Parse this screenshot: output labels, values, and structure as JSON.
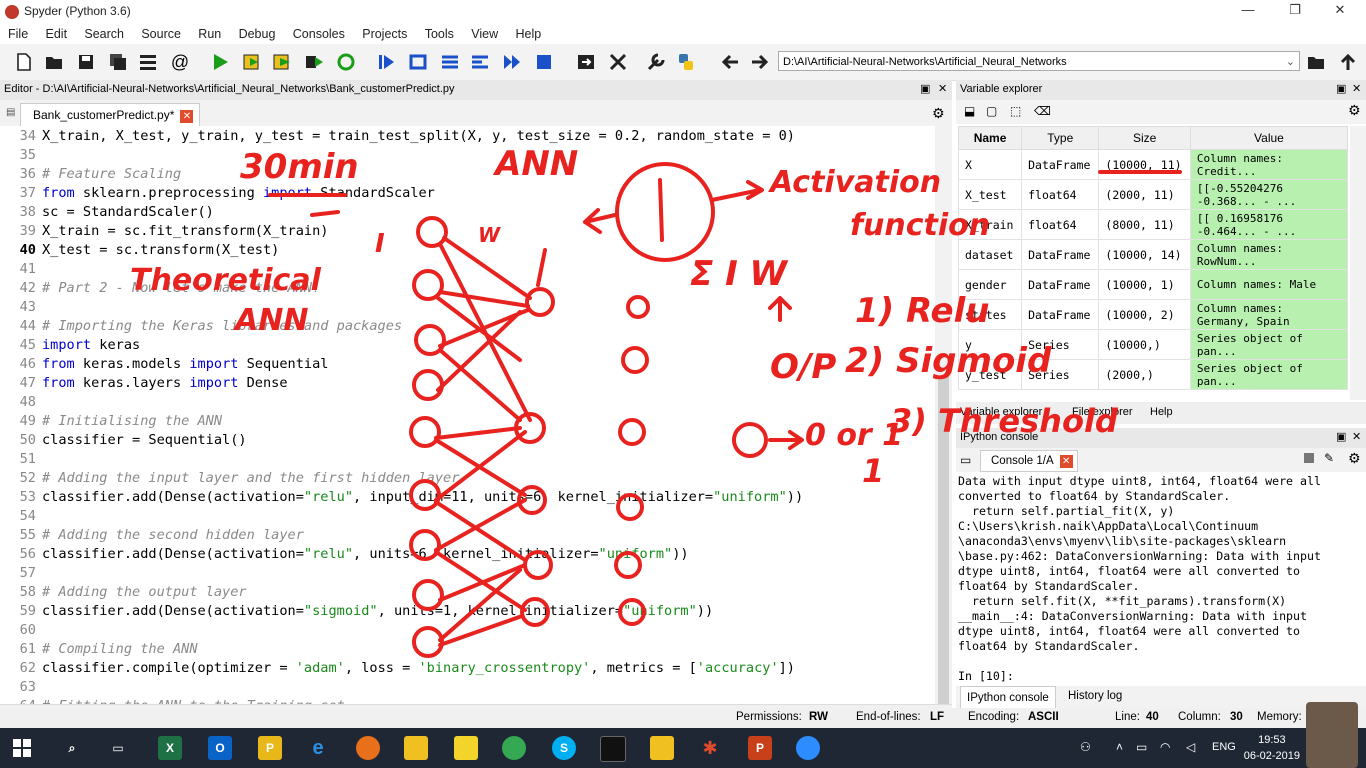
{
  "window": {
    "title": "Spyder (Python 3.6)",
    "minimize": "—",
    "restore": "❐",
    "close": "✕"
  },
  "menu": [
    "File",
    "Edit",
    "Search",
    "Source",
    "Run",
    "Debug",
    "Consoles",
    "Projects",
    "Tools",
    "View",
    "Help"
  ],
  "toolbar": {
    "path": "D:\\AI\\Artificial-Neural-Networks\\Artificial_Neural_Networks",
    "icons": [
      "new-file-icon",
      "open-file-icon",
      "save-icon",
      "save-all-icon",
      "outline-icon",
      "at-icon",
      "run-icon",
      "run-cell-icon",
      "run-cell-advance-icon",
      "run-selection-icon",
      "rerun-icon",
      "debug-icon",
      "step-icon",
      "step-into-icon",
      "step-return-icon",
      "continue-icon",
      "stop-icon",
      "maximize-pane-icon",
      "fullscreen-icon",
      "preferences-icon",
      "python-path-icon",
      "back-arrow-icon",
      "forward-arrow-icon"
    ]
  },
  "editor": {
    "header": "Editor - D:\\AI\\Artificial-Neural-Networks\\Artificial_Neural_Networks\\Bank_customerPredict.py",
    "tab": "Bank_customerPredict.py*",
    "lines": [
      {
        "n": "34",
        "text": "X_train, X_test, y_train, y_test = train_test_split(X, y, test_size = 0.2, random_state = 0)",
        "cls": ""
      },
      {
        "n": "35",
        "text": "",
        "cls": ""
      },
      {
        "n": "36",
        "text": "# Feature Scaling",
        "cls": "cm"
      },
      {
        "n": "37",
        "text": "from sklearn.preprocessing import StandardScaler",
        "cls": ""
      },
      {
        "n": "38",
        "text": "sc = StandardScaler()",
        "cls": ""
      },
      {
        "n": "39",
        "text": "X_train = sc.fit_transform(X_train)",
        "cls": ""
      },
      {
        "n": "40",
        "text": "X_test = sc.transform(X_test)",
        "cls": ""
      },
      {
        "n": "41",
        "text": "",
        "cls": ""
      },
      {
        "n": "42",
        "text": "# Part 2 - Now let's make the ANN!",
        "cls": "cm"
      },
      {
        "n": "43",
        "text": "",
        "cls": ""
      },
      {
        "n": "44",
        "text": "# Importing the Keras libraries and packages",
        "cls": "cm"
      },
      {
        "n": "45",
        "text": "import keras",
        "cls": ""
      },
      {
        "n": "46",
        "text": "from keras.models import Sequential",
        "cls": ""
      },
      {
        "n": "47",
        "text": "from keras.layers import Dense",
        "cls": ""
      },
      {
        "n": "48",
        "text": "",
        "cls": ""
      },
      {
        "n": "49",
        "text": "# Initialising the ANN",
        "cls": "cm"
      },
      {
        "n": "50",
        "text": "classifier = Sequential()",
        "cls": ""
      },
      {
        "n": "51",
        "text": "",
        "cls": ""
      },
      {
        "n": "52",
        "text": "# Adding the input layer and the first hidden layer",
        "cls": "cm"
      },
      {
        "n": "53",
        "text": "classifier.add(Dense(activation=\"relu\", input_dim=11, units=6, kernel_initializer=\"uniform\"))",
        "cls": ""
      },
      {
        "n": "54",
        "text": "",
        "cls": ""
      },
      {
        "n": "55",
        "text": "# Adding the second hidden layer",
        "cls": "cm"
      },
      {
        "n": "56",
        "text": "classifier.add(Dense(activation=\"relu\", units=6, kernel_initializer=\"uniform\"))",
        "cls": ""
      },
      {
        "n": "57",
        "text": "",
        "cls": ""
      },
      {
        "n": "58",
        "text": "# Adding the output layer",
        "cls": "cm"
      },
      {
        "n": "59",
        "text": "classifier.add(Dense(activation=\"sigmoid\", units=1, kernel_initializer=\"uniform\"))",
        "cls": ""
      },
      {
        "n": "60",
        "text": "",
        "cls": ""
      },
      {
        "n": "61",
        "text": "# Compiling the ANN",
        "cls": "cm"
      },
      {
        "n": "62",
        "text": "classifier.compile(optimizer = 'adam', loss = 'binary_crossentropy', metrics = ['accuracy'])",
        "cls": ""
      },
      {
        "n": "63",
        "text": "",
        "cls": ""
      },
      {
        "n": "64",
        "text": "# Fitting the ANN to the Training set",
        "cls": "cm"
      }
    ]
  },
  "variable_explorer": {
    "header": "Variable explorer",
    "columns": [
      "Name",
      "Type",
      "Size",
      "Value"
    ],
    "rows": [
      {
        "name": "X",
        "type": "DataFrame",
        "size": "(10000, 11)",
        "value": "Column names: Credit..."
      },
      {
        "name": "X_test",
        "type": "float64",
        "size": "(2000, 11)",
        "value": "[[-0.55204276 -0.368... - ..."
      },
      {
        "name": "X_train",
        "type": "float64",
        "size": "(8000, 11)",
        "value": "[[ 0.16958176 -0.464... - ..."
      },
      {
        "name": "dataset",
        "type": "DataFrame",
        "size": "(10000, 14)",
        "value": "Column names: RowNum..."
      },
      {
        "name": "gender",
        "type": "DataFrame",
        "size": "(10000, 1)",
        "value": "Column names: Male"
      },
      {
        "name": "states",
        "type": "DataFrame",
        "size": "(10000, 2)",
        "value": "Column names: Germany, Spain"
      },
      {
        "name": "y",
        "type": "Series",
        "size": "(10000,)",
        "value": "Series object of pan..."
      },
      {
        "name": "y_test",
        "type": "Series",
        "size": "(2000,)",
        "value": "Series object of pan..."
      }
    ],
    "tabs": [
      "Variable explorer",
      "File explorer",
      "Help"
    ]
  },
  "console": {
    "header": "IPython console",
    "tab": "Console 1/A",
    "text": "Data with input dtype uint8, int64, float64 were all\nconverted to float64 by StandardScaler.\n  return self.partial_fit(X, y)\nC:\\Users\\krish.naik\\AppData\\Local\\Continuum\n\\anaconda3\\envs\\myenv\\lib\\site-packages\\sklearn\n\\base.py:462: DataConversionWarning: Data with input\ndtype uint8, int64, float64 were all converted to\nfloat64 by StandardScaler.\n  return self.fit(X, **fit_params).transform(X)\n__main__:4: DataConversionWarning: Data with input\ndtype uint8, int64, float64 were all converted to\nfloat64 by StandardScaler.\n\nIn [10]:",
    "bottom_tabs": [
      "IPython console",
      "History log"
    ]
  },
  "statusbar": {
    "permissions_label": "Permissions:",
    "permissions": "RW",
    "eol_label": "End-of-lines:",
    "eol": "LF",
    "encoding_label": "Encoding:",
    "encoding": "ASCII",
    "line_label": "Line:",
    "line": "40",
    "column_label": "Column:",
    "column": "30",
    "memory_label": "Memory:"
  },
  "taskbar": {
    "lang": "ENG",
    "time": "19:53",
    "date": "06-02-2019"
  },
  "annotations": {
    "ink_color": "#e8231f",
    "texts": [
      "30min",
      "ANN",
      "Activation",
      "function",
      "Theoretical",
      "ANN",
      "Relu",
      "Sigmoid",
      "Threshold",
      "O/P",
      "1)",
      "2)",
      "3)",
      "0 or 1",
      "I",
      "W",
      "Σ I W"
    ]
  }
}
